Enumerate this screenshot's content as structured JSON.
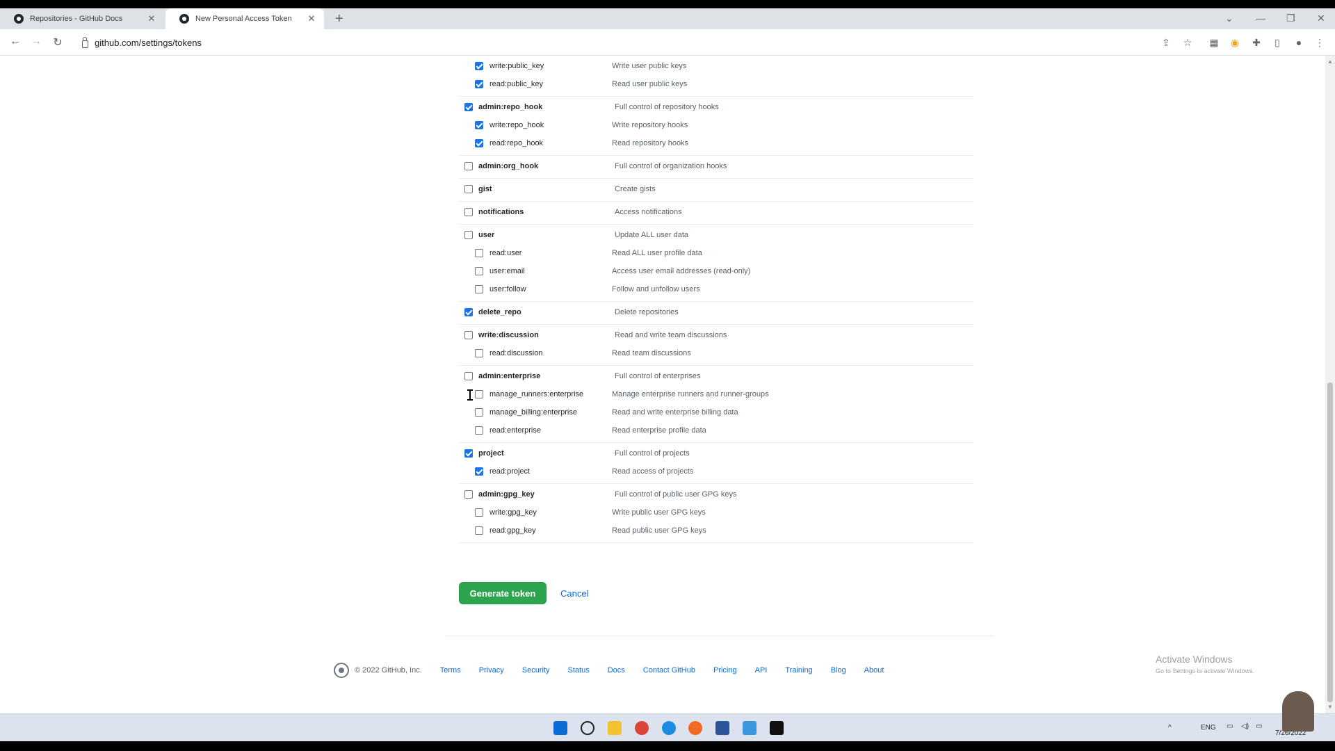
{
  "browser": {
    "tabs": [
      {
        "title": "Repositories - GitHub Docs",
        "close": "✕"
      },
      {
        "title": "New Personal Access Token",
        "close": "✕"
      }
    ],
    "new_tab": "+",
    "url": "github.com/settings/tokens"
  },
  "scope_groups": [
    {
      "items": [
        {
          "level": "child",
          "checked": true,
          "name": "write:public_key",
          "desc": "Write user public keys"
        },
        {
          "level": "child",
          "checked": true,
          "name": "read:public_key",
          "desc": "Read user public keys"
        }
      ]
    },
    {
      "items": [
        {
          "level": "parent",
          "checked": true,
          "name": "admin:repo_hook",
          "desc": "Full control of repository hooks"
        },
        {
          "level": "child",
          "checked": true,
          "name": "write:repo_hook",
          "desc": "Write repository hooks"
        },
        {
          "level": "child",
          "checked": true,
          "name": "read:repo_hook",
          "desc": "Read repository hooks"
        }
      ]
    },
    {
      "items": [
        {
          "level": "parent",
          "checked": false,
          "name": "admin:org_hook",
          "desc": "Full control of organization hooks"
        }
      ]
    },
    {
      "items": [
        {
          "level": "parent",
          "checked": false,
          "name": "gist",
          "desc": "Create gists"
        }
      ]
    },
    {
      "items": [
        {
          "level": "parent",
          "checked": false,
          "name": "notifications",
          "desc": "Access notifications"
        }
      ]
    },
    {
      "items": [
        {
          "level": "parent",
          "checked": false,
          "name": "user",
          "desc": "Update ALL user data"
        },
        {
          "level": "child",
          "checked": false,
          "name": "read:user",
          "desc": "Read ALL user profile data"
        },
        {
          "level": "child",
          "checked": false,
          "name": "user:email",
          "desc": "Access user email addresses (read-only)"
        },
        {
          "level": "child",
          "checked": false,
          "name": "user:follow",
          "desc": "Follow and unfollow users"
        }
      ]
    },
    {
      "items": [
        {
          "level": "parent",
          "checked": true,
          "name": "delete_repo",
          "desc": "Delete repositories"
        }
      ]
    },
    {
      "items": [
        {
          "level": "parent",
          "checked": false,
          "name": "write:discussion",
          "desc": "Read and write team discussions"
        },
        {
          "level": "child",
          "checked": false,
          "name": "read:discussion",
          "desc": "Read team discussions"
        }
      ]
    },
    {
      "items": [
        {
          "level": "parent",
          "checked": false,
          "name": "admin:enterprise",
          "desc": "Full control of enterprises"
        },
        {
          "level": "child",
          "checked": false,
          "name": "manage_runners:enterprise",
          "desc": "Manage enterprise runners and runner-groups"
        },
        {
          "level": "child",
          "checked": false,
          "name": "manage_billing:enterprise",
          "desc": "Read and write enterprise billing data"
        },
        {
          "level": "child",
          "checked": false,
          "name": "read:enterprise",
          "desc": "Read enterprise profile data"
        }
      ]
    },
    {
      "items": [
        {
          "level": "parent",
          "checked": true,
          "name": "project",
          "desc": "Full control of projects"
        },
        {
          "level": "child",
          "checked": true,
          "name": "read:project",
          "desc": "Read access of projects"
        }
      ]
    },
    {
      "items": [
        {
          "level": "parent",
          "checked": false,
          "name": "admin:gpg_key",
          "desc": "Full control of public user GPG keys"
        },
        {
          "level": "child",
          "checked": false,
          "name": "write:gpg_key",
          "desc": "Write public user GPG keys"
        },
        {
          "level": "child",
          "checked": false,
          "name": "read:gpg_key",
          "desc": "Read public user GPG keys"
        }
      ]
    }
  ],
  "actions": {
    "generate_label": "Generate token",
    "cancel_label": "Cancel"
  },
  "footer": {
    "copyright": "© 2022 GitHub, Inc.",
    "links": [
      "Terms",
      "Privacy",
      "Security",
      "Status",
      "Docs",
      "Contact GitHub",
      "Pricing",
      "API",
      "Training",
      "Blog",
      "About"
    ]
  },
  "watermark": {
    "line1": "Activate Windows",
    "line2": "Go to Settings to activate Windows."
  },
  "taskbar": {
    "lang": "ENG",
    "date": "7/26/2022"
  },
  "colors": {
    "generate_button": "#2da44e",
    "link": "#0969da",
    "checkbox_checked": "#1a73e8"
  }
}
